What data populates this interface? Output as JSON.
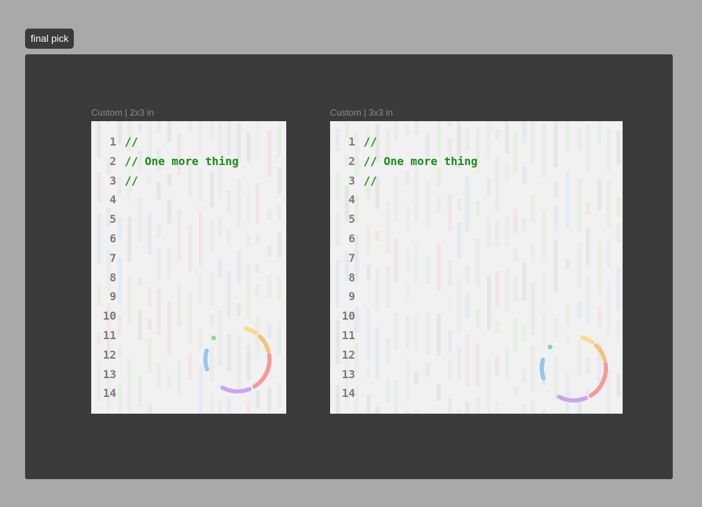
{
  "tag": {
    "label": "final pick"
  },
  "artboards": [
    {
      "label": "Custom | 2x3 in",
      "lines": [
        {
          "n": "1",
          "text": "//"
        },
        {
          "n": "2",
          "text": "// One more thing"
        },
        {
          "n": "3",
          "text": "//"
        },
        {
          "n": "4",
          "text": ""
        },
        {
          "n": "5",
          "text": ""
        },
        {
          "n": "6",
          "text": ""
        },
        {
          "n": "7",
          "text": ""
        },
        {
          "n": "8",
          "text": ""
        },
        {
          "n": "9",
          "text": ""
        },
        {
          "n": "10",
          "text": ""
        },
        {
          "n": "11",
          "text": ""
        },
        {
          "n": "12",
          "text": ""
        },
        {
          "n": "13",
          "text": ""
        },
        {
          "n": "14",
          "text": ""
        }
      ]
    },
    {
      "label": "Custom | 3x3 in",
      "lines": [
        {
          "n": "1",
          "text": "//"
        },
        {
          "n": "2",
          "text": "// One more thing"
        },
        {
          "n": "3",
          "text": "//"
        },
        {
          "n": "4",
          "text": ""
        },
        {
          "n": "5",
          "text": ""
        },
        {
          "n": "6",
          "text": ""
        },
        {
          "n": "7",
          "text": ""
        },
        {
          "n": "8",
          "text": ""
        },
        {
          "n": "9",
          "text": ""
        },
        {
          "n": "10",
          "text": ""
        },
        {
          "n": "11",
          "text": ""
        },
        {
          "n": "12",
          "text": ""
        },
        {
          "n": "13",
          "text": ""
        },
        {
          "n": "14",
          "text": ""
        }
      ]
    }
  ],
  "colors": {
    "canvas": "#a9a9a9",
    "frame": "#3b3b3b",
    "card": "#f1f1f1",
    "code_comment": "#1a8c1a",
    "line_number": "#7b7b7b",
    "ring_segments": [
      "#93c8ea",
      "#f7dc8a",
      "#f5c27a",
      "#f49a9a",
      "#c9a6ec",
      "#8fd99a"
    ]
  }
}
